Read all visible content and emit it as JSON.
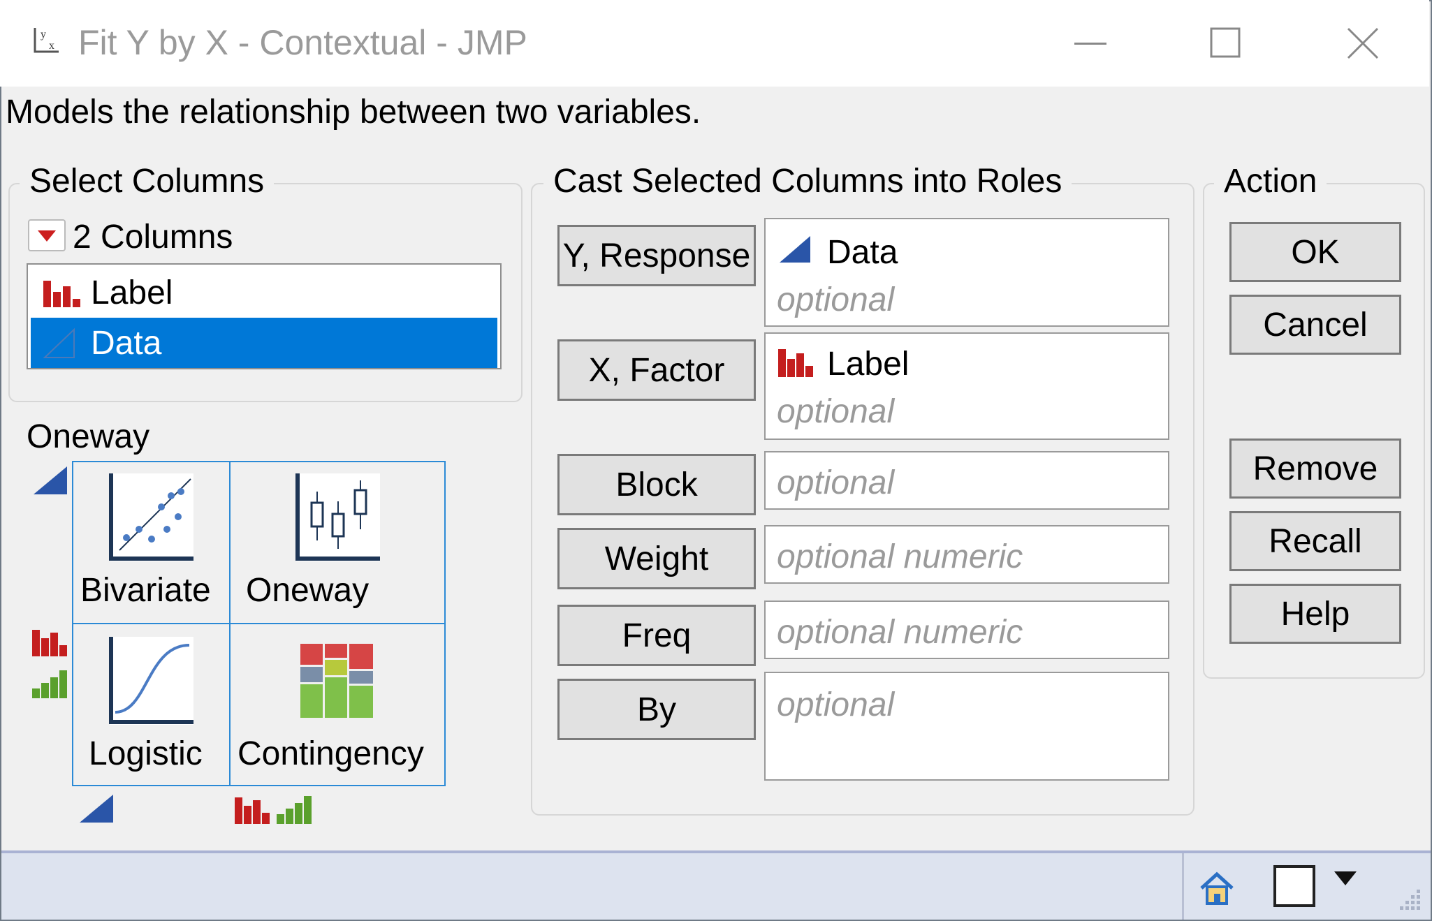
{
  "window": {
    "title": "Fit Y by X - Contextual - JMP",
    "minimize": "—",
    "maximize": "☐",
    "close": "✕"
  },
  "description": "Models the relationship between two variables.",
  "select_columns": {
    "legend": "Select Columns",
    "count_label": "2 Columns",
    "items": [
      {
        "label": "Label",
        "icon": "nominal-bar-icon",
        "selected": false
      },
      {
        "label": "Data",
        "icon": "continuous-triangle-icon",
        "selected": true
      }
    ]
  },
  "platform": {
    "current": "Oneway",
    "tiles": [
      {
        "label": "Bivariate",
        "icon": "scatter-plot-icon"
      },
      {
        "label": "Oneway",
        "icon": "box-plot-icon"
      },
      {
        "label": "Logistic",
        "icon": "logistic-curve-icon"
      },
      {
        "label": "Contingency",
        "icon": "mosaic-plot-icon"
      }
    ]
  },
  "roles": {
    "legend": "Cast Selected Columns into Roles",
    "items": [
      {
        "button": "Y, Response",
        "assigned": "Data",
        "placeholder": "optional"
      },
      {
        "button": "X, Factor",
        "assigned": "Label",
        "placeholder": "optional"
      },
      {
        "button": "Block",
        "placeholder": "optional"
      },
      {
        "button": "Weight",
        "placeholder": "optional numeric"
      },
      {
        "button": "Freq",
        "placeholder": "optional numeric"
      },
      {
        "button": "By",
        "placeholder": "optional"
      }
    ]
  },
  "action": {
    "legend": "Action",
    "ok": "OK",
    "cancel": "Cancel",
    "remove": "Remove",
    "recall": "Recall",
    "help": "Help"
  },
  "status": {
    "icons": [
      "home-icon",
      "window-icon",
      "dropdown-arrow-icon",
      "resize-grip-icon"
    ]
  },
  "colors": {
    "selection": "#0078d7",
    "tile_border": "#2b8ad6",
    "nominal_red": "#c41e1e",
    "ordinal_green": "#5aa02c",
    "continuous_blue": "#2a55a8"
  }
}
